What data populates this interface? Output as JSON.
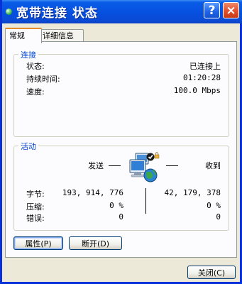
{
  "window": {
    "title": "宽带连接 状态",
    "help_label": "?",
    "close_label": "×"
  },
  "tabs": [
    {
      "label": "常规",
      "active": true
    },
    {
      "label": "详细信息",
      "active": false
    }
  ],
  "connection": {
    "title": "连接",
    "rows": [
      {
        "label": "状态:",
        "value": "已连接上"
      },
      {
        "label": "持续时间:",
        "value": "01:20:28"
      },
      {
        "label": "速度:",
        "value": "100.0 Mbps"
      }
    ]
  },
  "activity": {
    "title": "活动",
    "sent_label": "发送",
    "received_label": "收到",
    "rows": [
      {
        "label": "字节:",
        "sent": "193, 914, 776",
        "received": "42, 179, 378"
      },
      {
        "label": "压缩:",
        "sent": "0 %",
        "received": "0 %"
      },
      {
        "label": "错误:",
        "sent": "0",
        "received": "0"
      }
    ]
  },
  "buttons": {
    "properties": "属性(P)",
    "disconnect": "断开(D)",
    "close": "关闭(C)"
  },
  "icons": {
    "title": "network-connection-icon",
    "activity": "network-computers-globe-icon"
  },
  "colors": {
    "titlebar": "#0650e0",
    "group_title": "#0046d5",
    "tab_highlight": "#e68b2c"
  }
}
